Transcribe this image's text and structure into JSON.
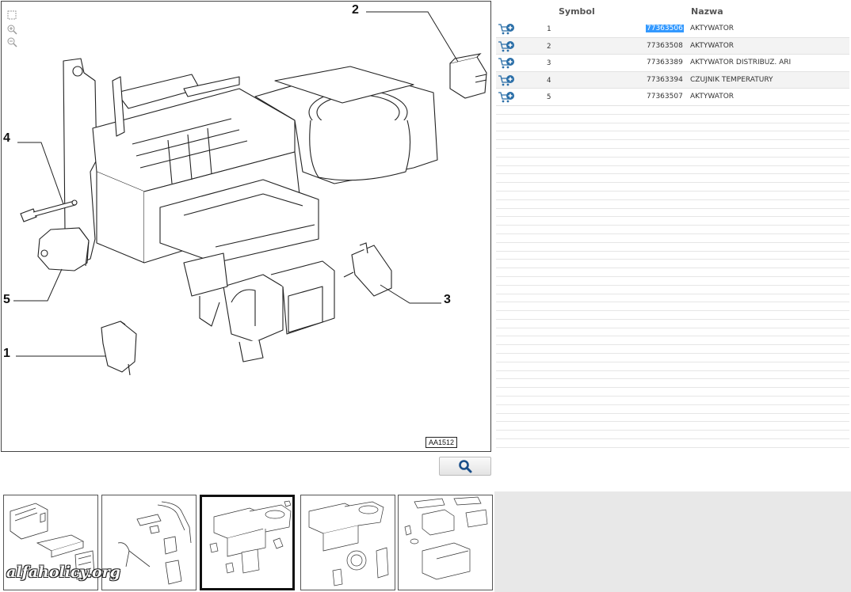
{
  "diagram": {
    "code": "AA1512",
    "callouts": [
      "1",
      "2",
      "3",
      "4",
      "5"
    ],
    "tools": [
      "select-icon",
      "zoom-in-icon",
      "zoom-out-icon"
    ]
  },
  "search_button": {
    "icon": "search-icon"
  },
  "table": {
    "headers": {
      "symbol": "Symbol",
      "name": "Nazwa"
    },
    "rows": [
      {
        "symbol": "1",
        "number": "77363506",
        "name": "AKTYWATOR"
      },
      {
        "symbol": "2",
        "number": "77363508",
        "name": "AKTYWATOR"
      },
      {
        "symbol": "3",
        "number": "77363389",
        "name": "AKTYWATOR DISTRIBUZ. ARI"
      },
      {
        "symbol": "4",
        "number": "77363394",
        "name": "CZUJNIK TEMPERATURY"
      },
      {
        "symbol": "5",
        "number": "77363507",
        "name": "AKTYWATOR"
      }
    ],
    "row_icon": "cart-add-icon",
    "selected_color": "#3399ff"
  },
  "thumbnails": {
    "count": 5,
    "active_index": 2
  },
  "watermark": "alfaholicy.org"
}
